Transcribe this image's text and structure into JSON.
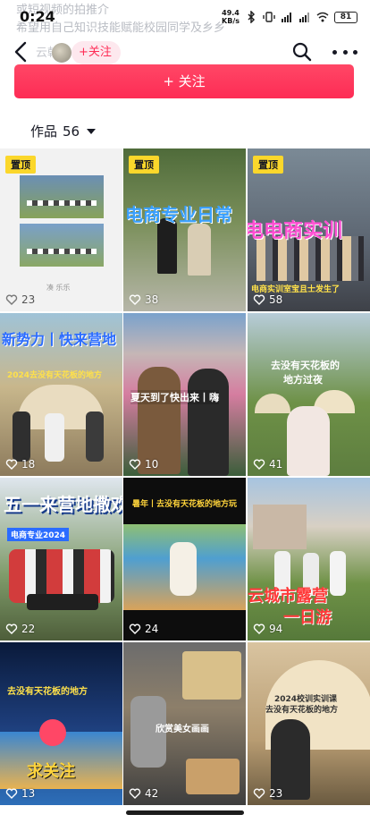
{
  "status": {
    "time": "0:24",
    "speed_value": "49.4",
    "speed_unit": "KB/s",
    "battery": "81"
  },
  "bio": {
    "line1": "或短视频的拍推介",
    "line2": "希望用自己知识技能赋能校园同学及乡乡"
  },
  "nav": {
    "name_ghost": "云朝",
    "follow_small": "+关注"
  },
  "follow_button": "+ 关注",
  "works": {
    "label": "作品",
    "count": "56"
  },
  "tiles": [
    {
      "pinned": "置顶",
      "likes": "23",
      "caption": "凑  乐乐"
    },
    {
      "pinned": "置顶",
      "likes": "38",
      "caption": "电商专业日常"
    },
    {
      "pinned": "置顶",
      "likes": "58",
      "caption": "电电商实训",
      "caption2": "电商实训室宝且士发生了"
    },
    {
      "likes": "18",
      "caption": "新势力丨快来营地",
      "caption2": "2024去没有天花板的地方"
    },
    {
      "likes": "10",
      "caption": "夏天到了快出来丨嗨"
    },
    {
      "likes": "41",
      "caption": "去没有天花板的",
      "caption2": "地方过夜"
    },
    {
      "likes": "22",
      "caption": "五一来营地撒欢",
      "caption2": "电商专业2024"
    },
    {
      "likes": "24",
      "caption": "暑年丨去没有天花板的地方玩"
    },
    {
      "likes": "94",
      "caption": "云城市露营",
      "caption2": "一日游"
    },
    {
      "likes": "13",
      "caption": "去没有天花板的地方",
      "caption2": "求关注"
    },
    {
      "likes": "42",
      "caption": "欣赏美女画画"
    },
    {
      "likes": "23",
      "caption": "2024校训实训课",
      "caption2": "去没有天花板的地方"
    }
  ],
  "colors": {
    "accent": "#fe2c55",
    "pin": "#fbd72b"
  }
}
